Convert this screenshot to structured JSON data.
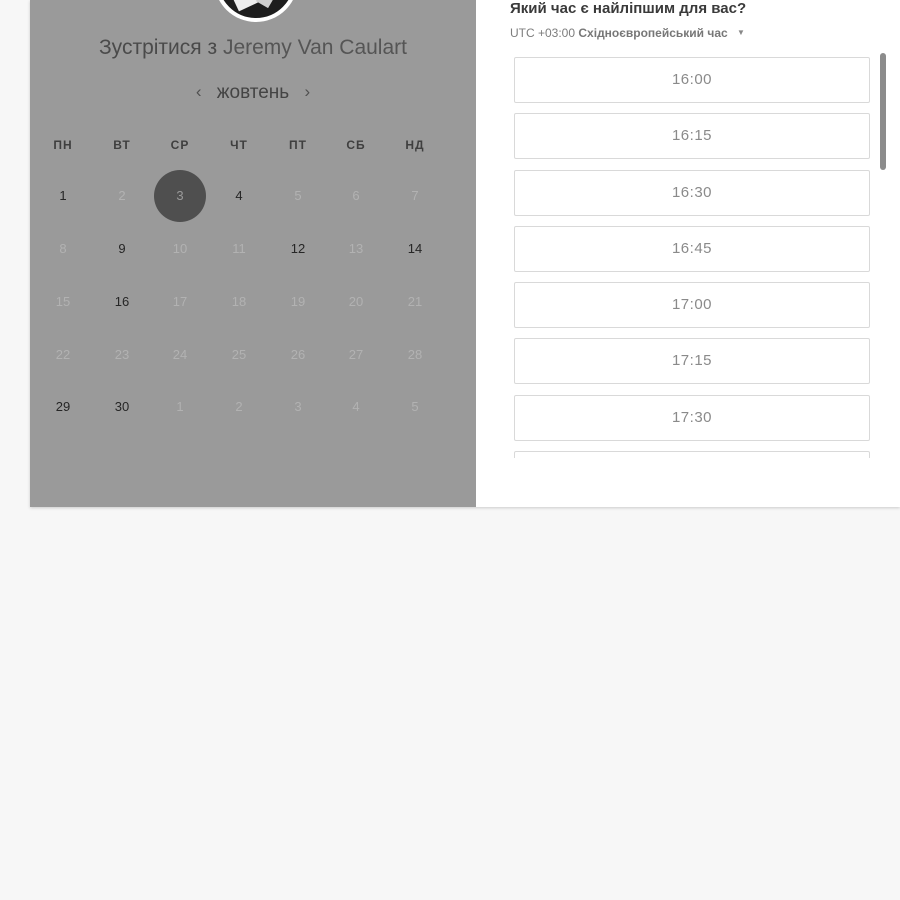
{
  "calendar": {
    "title_prefix": "Зустрітися з",
    "host_name": "Jeremy Van Caulart",
    "month": "жовтень",
    "prev_icon": "‹",
    "next_icon": "›",
    "weekdays": [
      "ПН",
      "ВТ",
      "СР",
      "ЧТ",
      "ПТ",
      "СБ",
      "НД"
    ],
    "weeks": [
      [
        {
          "d": "1",
          "s": "avail"
        },
        {
          "d": "2",
          "s": "off"
        },
        {
          "d": "3",
          "s": "selected"
        },
        {
          "d": "4",
          "s": "avail"
        },
        {
          "d": "5",
          "s": "off"
        },
        {
          "d": "6",
          "s": "off"
        },
        {
          "d": "7",
          "s": "off"
        }
      ],
      [
        {
          "d": "8",
          "s": "off"
        },
        {
          "d": "9",
          "s": "avail"
        },
        {
          "d": "10",
          "s": "off"
        },
        {
          "d": "11",
          "s": "off"
        },
        {
          "d": "12",
          "s": "avail"
        },
        {
          "d": "13",
          "s": "off"
        },
        {
          "d": "14",
          "s": "avail"
        }
      ],
      [
        {
          "d": "15",
          "s": "off"
        },
        {
          "d": "16",
          "s": "avail"
        },
        {
          "d": "17",
          "s": "off"
        },
        {
          "d": "18",
          "s": "off"
        },
        {
          "d": "19",
          "s": "off"
        },
        {
          "d": "20",
          "s": "off"
        },
        {
          "d": "21",
          "s": "off"
        }
      ],
      [
        {
          "d": "22",
          "s": "off"
        },
        {
          "d": "23",
          "s": "off"
        },
        {
          "d": "24",
          "s": "off"
        },
        {
          "d": "25",
          "s": "off"
        },
        {
          "d": "26",
          "s": "off"
        },
        {
          "d": "27",
          "s": "off"
        },
        {
          "d": "28",
          "s": "off"
        }
      ],
      [
        {
          "d": "29",
          "s": "avail"
        },
        {
          "d": "30",
          "s": "avail"
        },
        {
          "d": "1",
          "s": "off"
        },
        {
          "d": "2",
          "s": "off"
        },
        {
          "d": "3",
          "s": "off"
        },
        {
          "d": "4",
          "s": "off"
        },
        {
          "d": "5",
          "s": "off"
        }
      ]
    ]
  },
  "times": {
    "question": "Який час є найліпшим для вас?",
    "timezone_offset": "UTC +03:00",
    "timezone_name": "Східноєвропейський час",
    "slots": [
      "16:00",
      "16:15",
      "16:30",
      "16:45",
      "17:00",
      "17:15",
      "17:30",
      ""
    ]
  },
  "colors": {
    "overlay_grey": "#9a9a9a",
    "selected_day": "#4f4f4f",
    "page_background": "#f7f7f7"
  }
}
